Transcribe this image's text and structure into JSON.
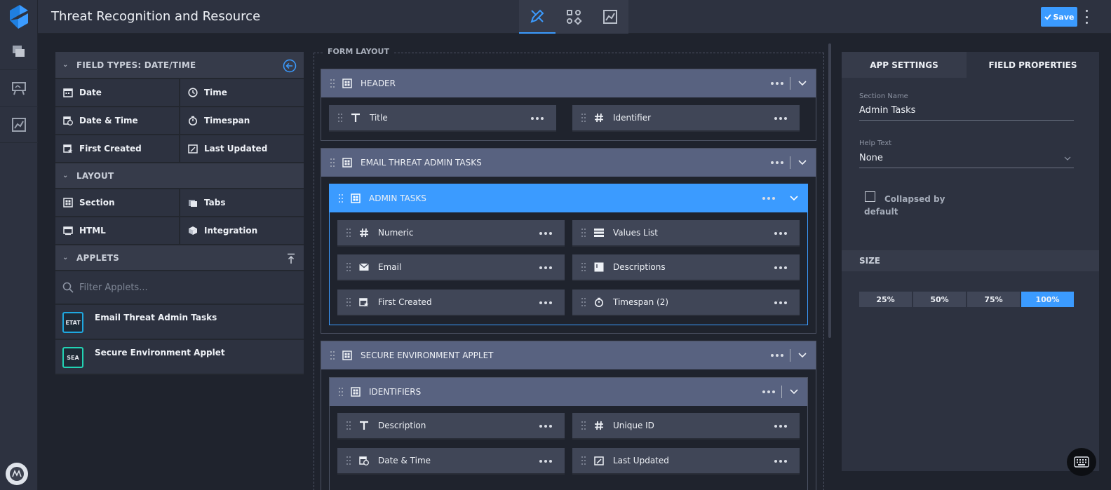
{
  "app": {
    "title": "Threat Recognition and Resource"
  },
  "colors": {
    "accent": "#3b9bff",
    "section_header": "#586280",
    "etat_badge": "#1fa8e0",
    "sea_badge": "#22d3b4"
  },
  "toolbar": {
    "save_label": "Save",
    "mode_tabs": [
      "designer-icon",
      "workflow-icon",
      "reports-icon"
    ]
  },
  "palette": {
    "field_types_header": "FIELD TYPES: DATE/TIME",
    "field_types": [
      {
        "label": "Date",
        "icon": "calendar-icon"
      },
      {
        "label": "Time",
        "icon": "clock-icon"
      },
      {
        "label": "Date & Time",
        "icon": "datetime-icon"
      },
      {
        "label": "Timespan",
        "icon": "timer-icon"
      },
      {
        "label": "First Created",
        "icon": "calendar-star-icon"
      },
      {
        "label": "Last Updated",
        "icon": "calendar-edit-icon"
      }
    ],
    "layout_header": "LAYOUT",
    "layout_items": [
      {
        "label": "Section",
        "icon": "section-grid-icon"
      },
      {
        "label": "Tabs",
        "icon": "tabs-icon"
      },
      {
        "label": "HTML",
        "icon": "html-icon"
      },
      {
        "label": "Integration",
        "icon": "cube-icon"
      }
    ],
    "applets_header": "APPLETS",
    "filter_placeholder": "Filter Applets...",
    "applets": [
      {
        "badge": "ETAT",
        "name": "Email Threat Admin Tasks"
      },
      {
        "badge": "SEA",
        "name": "Secure Environment Applet"
      }
    ]
  },
  "canvas": {
    "legend": "FORM LAYOUT",
    "header_section": {
      "title": "HEADER",
      "fields": [
        "Title",
        "Identifier"
      ]
    },
    "email_section": {
      "title": "EMAIL THREAT ADMIN TASKS"
    },
    "admin_tasks": {
      "title": "ADMIN TASKS",
      "fields": [
        "Numeric",
        "Values List",
        "Email",
        "Descriptions",
        "First Created",
        "Timespan (2)"
      ]
    },
    "secure_section": {
      "title": "SECURE ENVIRONMENT APPLET"
    },
    "identifiers": {
      "title": "IDENTIFIERS",
      "fields": [
        "Description",
        "Unique ID",
        "Date & Time",
        "Last Updated"
      ]
    }
  },
  "props": {
    "tabs": [
      "APP SETTINGS",
      "FIELD PROPERTIES"
    ],
    "section_name_label": "Section Name",
    "section_name_value": "Admin Tasks",
    "help_text_label": "Help Text",
    "help_text_value": "None",
    "collapsed_label": "Collapsed by default",
    "size_header": "SIZE",
    "sizes": [
      "25%",
      "50%",
      "75%",
      "100%"
    ],
    "selected_size": "100%"
  }
}
